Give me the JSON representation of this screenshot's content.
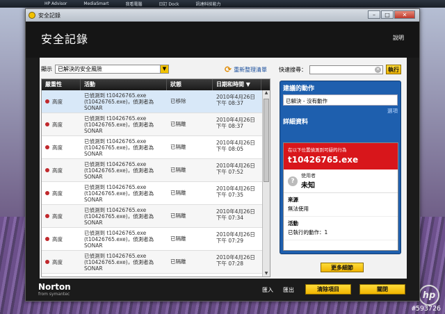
{
  "taskbar": [
    "HP Advisor",
    "MediaSmart",
    "我看電腦",
    "日訂 Dock",
    "訊達科技能力"
  ],
  "window": {
    "titlebar": "安全記錄",
    "title": "安全記錄",
    "help": "說明"
  },
  "filter": {
    "label": "顯示",
    "selected": "已解決的安全風險",
    "refresh": "重新整理清單"
  },
  "quick_search": {
    "label": "快速搜尋：",
    "button": "執行"
  },
  "table": {
    "headers": [
      "嚴重性",
      "活動",
      "狀態",
      "日期和時間"
    ],
    "rows": [
      {
        "severity": "高度",
        "activity": "已偵測到 t10426765.exe (t10426765.exe)，偵測者為 SONAR",
        "status": "已移除",
        "date": "2010年4月26日",
        "time": "下午 08:37"
      },
      {
        "severity": "高度",
        "activity": "已偵測到 t10426765.exe (t10426765.exe)，偵測者為 SONAR",
        "status": "已隔離",
        "date": "2010年4月26日",
        "time": "下午 08:37"
      },
      {
        "severity": "高度",
        "activity": "已偵測到 t10426765.exe (t10426765.exe)，偵測者為 SONAR",
        "status": "已隔離",
        "date": "2010年4月26日",
        "time": "下午 08:05"
      },
      {
        "severity": "高度",
        "activity": "已偵測到 t10426765.exe (t10426765.exe)，偵測者為 SONAR",
        "status": "已隔離",
        "date": "2010年4月26日",
        "time": "下午 07:52"
      },
      {
        "severity": "高度",
        "activity": "已偵測到 t10426765.exe (t10426765.exe)，偵測者為 SONAR",
        "status": "已隔離",
        "date": "2010年4月26日",
        "time": "下午 07:35"
      },
      {
        "severity": "高度",
        "activity": "已偵測到 t10426765.exe (t10426765.exe)，偵測者為 SONAR",
        "status": "已隔離",
        "date": "2010年4月26日",
        "time": "下午 07:34"
      },
      {
        "severity": "高度",
        "activity": "已偵測到 t10426765.exe (t10426765.exe)，偵測者為 SONAR",
        "status": "已隔離",
        "date": "2010年4月26日",
        "time": "下午 07:29"
      },
      {
        "severity": "高度",
        "activity": "已偵測到 t10426765.exe (t10426765.exe)，偵測者為 SONAR",
        "status": "已隔離",
        "date": "2010年4月26日",
        "time": "下午 07:28"
      }
    ]
  },
  "panel": {
    "recommended_title": "建議的動作",
    "recommended_value": "已解決 - 沒有動作",
    "options": "選項",
    "details_title": "詳細資料",
    "alert_small": "在以下位置偵測到可疑的行為",
    "alert_big": "t10426765.exe",
    "user_label": "使用者",
    "user_value": "未知",
    "source_label": "來源",
    "source_value": "無法使用",
    "activity_label": "活動",
    "activity_value": "已執行的動作：1",
    "more_button": "更多細節"
  },
  "footer": {
    "brand": "Norton",
    "brand_sub": "from symantec",
    "import": "匯入",
    "export": "匯出",
    "clear": "清除項目",
    "close": "關閉"
  },
  "watermark": "#593726",
  "colors": {
    "accent": "#f0b400",
    "panel": "#1e5fae",
    "alert": "#d8161b",
    "severity_dot": "#c0282c"
  }
}
